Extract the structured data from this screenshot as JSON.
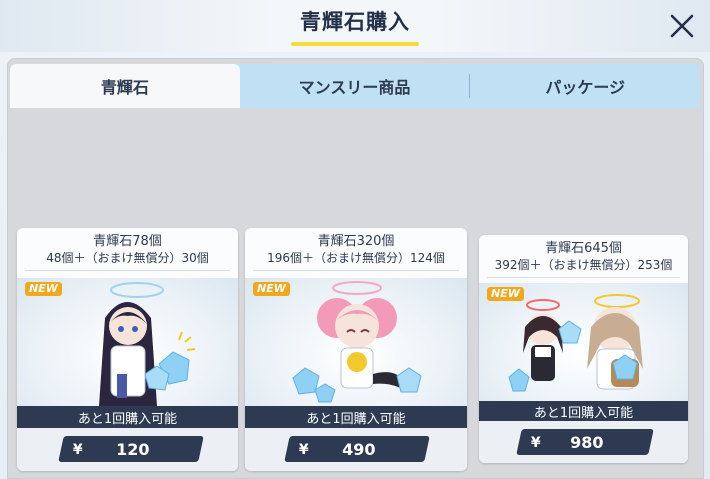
{
  "window": {
    "title": "青輝石購入"
  },
  "tabs": [
    {
      "label": "青輝石",
      "active": true
    },
    {
      "label": "マンスリー商品",
      "active": false
    },
    {
      "label": "パッケージ",
      "active": false
    }
  ],
  "products": [
    {
      "name": "青輝石78個",
      "detail": "48個＋（おまけ無償分）30個",
      "badge": "NEW",
      "limit": "あと1回購入可能",
      "currency": "¥",
      "price": "120"
    },
    {
      "name": "青輝石320個",
      "detail": "196個＋（おまけ無償分）124個",
      "badge": "NEW",
      "limit": "あと1回購入可能",
      "currency": "¥",
      "price": "490"
    },
    {
      "name": "青輝石645個",
      "detail": "392個＋（おまけ無償分）253個",
      "badge": "NEW",
      "limit": "あと1回購入可能",
      "currency": "¥",
      "price": "980"
    }
  ],
  "icons": {
    "close": "close-icon",
    "gem": "gem-icon",
    "character": "character-illustration"
  },
  "colors": {
    "accent_underline": "#f5dd3c",
    "dark_bar": "#2d3a52",
    "tab_bar": "#bfe1f3",
    "badge_new": "#f2a81d",
    "gem_blue": "#8fd0f5"
  }
}
